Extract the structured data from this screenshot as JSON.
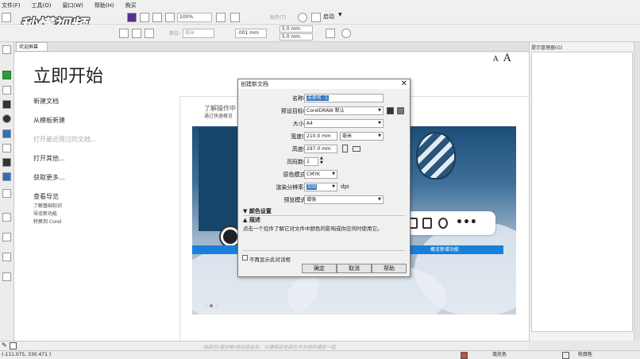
{
  "menu": {
    "items": [
      "文件(F)",
      "工具(O)",
      "窗口(W)",
      "帮助(H)",
      "购买"
    ]
  },
  "toolbar": {
    "zoom": "100%",
    "snap_label": "贴齐(T)",
    "launch_label": "启动",
    "unit_label": "单位:",
    "unit_value": "毫米",
    "nudge_value": ".001 mm",
    "dup_x": "5.0 mm",
    "dup_y": "5.0 mm"
  },
  "watermark_logo": "秒懂视频",
  "tabs": {
    "welcome": "欢迎屏幕"
  },
  "welcome": {
    "title": "立即开始",
    "links": [
      "新建文档",
      "从模板新建",
      "打开最近用过的文档...",
      "打开其他...",
      "获取更多...",
      "查看导览"
    ],
    "sub_links": [
      "了解基础知识",
      "导览新功能",
      "转换到 Corel"
    ],
    "panel_text": [
      "了解操作中",
      "通过快速概览"
    ],
    "blue_bar_text": "概览新增功能",
    "font_small": "A",
    "font_large": "A"
  },
  "docker": {
    "title": "提示管理器(G)"
  },
  "palette_hint": "将颜色(或对象)拖动至此处，以便将这些颜色与文档存储在一起",
  "status": {
    "coords": "(-111.075, 330.471 )",
    "fill_label": "填充色",
    "outline_label": "轮廓色"
  },
  "dialog": {
    "title": "创建新文档",
    "fields": {
      "name_label": "名称(N):",
      "name_value": "未命名 -1",
      "preset_label": "预设目标(D):",
      "preset_value": "CorelDRAW 默认",
      "size_label": "大小(S):",
      "size_value": "A4",
      "width_label": "宽度(W):",
      "width_value": "210.0 mm",
      "width_unit": "毫米",
      "height_label": "高度(H):",
      "height_value": "297.0 mm",
      "pages_label": "页码数(N):",
      "pages_value": "1",
      "color_mode_label": "原色模式(C)",
      "color_mode_value": "CMYK",
      "resolution_label": "渲染分辨率(R):",
      "resolution_value": "300",
      "resolution_unit": "dpi",
      "preview_label": "预览模式(P)",
      "preview_value": "增强"
    },
    "color_settings": "颜色设置",
    "description_title": "描述",
    "description": "点击一个控件了解它对文件中颜色的影响或你应何时使用它。",
    "dont_show": "不再显示此对话框",
    "buttons": {
      "ok": "确定",
      "cancel": "取消",
      "help": "帮助"
    }
  }
}
